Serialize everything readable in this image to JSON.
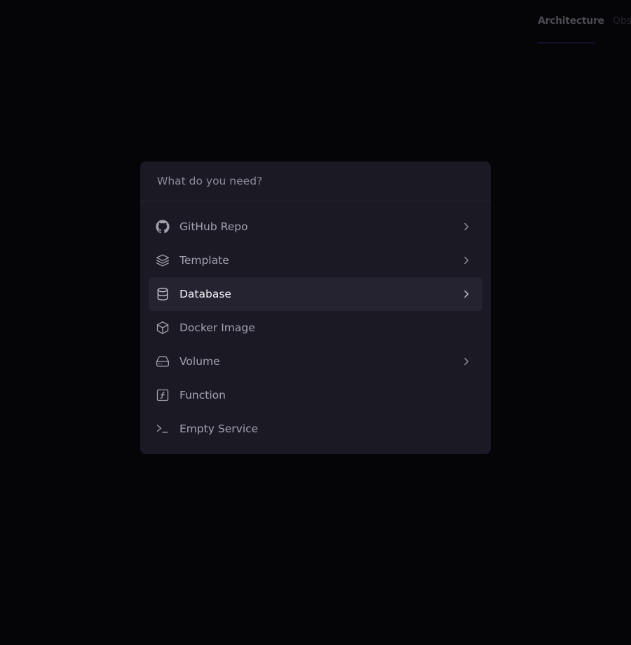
{
  "header": {
    "tabs": [
      {
        "label": "Architecture",
        "active": true
      },
      {
        "label": "Obs",
        "active": false
      }
    ]
  },
  "dialog": {
    "search": {
      "placeholder": "What do you need?",
      "value": ""
    },
    "items": [
      {
        "label": "GitHub Repo",
        "icon": "github-icon",
        "has_submenu": true,
        "selected": false
      },
      {
        "label": "Template",
        "icon": "layers-icon",
        "has_submenu": true,
        "selected": false
      },
      {
        "label": "Database",
        "icon": "database-icon",
        "has_submenu": true,
        "selected": true
      },
      {
        "label": "Docker Image",
        "icon": "box-icon",
        "has_submenu": false,
        "selected": false
      },
      {
        "label": "Volume",
        "icon": "hard-drive-icon",
        "has_submenu": true,
        "selected": false
      },
      {
        "label": "Function",
        "icon": "function-icon",
        "has_submenu": false,
        "selected": false
      },
      {
        "label": "Empty Service",
        "icon": "terminal-icon",
        "has_submenu": false,
        "selected": false
      }
    ]
  },
  "colors": {
    "background": "#050407",
    "dialog_bg": "#1b1a24",
    "selected_bg": "#25232f",
    "text_muted": "#a4a1af",
    "text_selected": "#f4f3f8"
  }
}
